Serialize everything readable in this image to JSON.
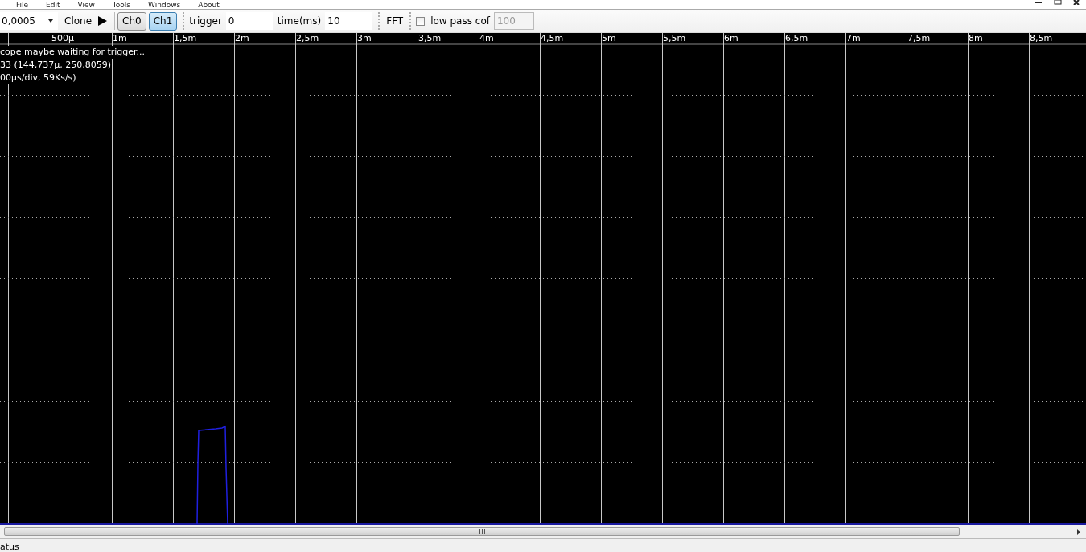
{
  "menu": [
    {
      "label": "File"
    },
    {
      "label": "Edit"
    },
    {
      "label": "View"
    },
    {
      "label": "Tools"
    },
    {
      "label": "Windows"
    },
    {
      "label": "About"
    }
  ],
  "toolbar": {
    "sample_combo": {
      "value": "0,0005"
    },
    "clone_button": "Clone",
    "channels": [
      {
        "label": "Ch0",
        "selected": false
      },
      {
        "label": "Ch1",
        "selected": true
      }
    ],
    "trigger": {
      "label": "trigger",
      "value": "0"
    },
    "time": {
      "label": "time(ms)",
      "value": "10"
    },
    "fft_button": "FFT",
    "low_pass": {
      "label": "low pass cof",
      "checked": false,
      "value": "100",
      "disabled": true
    }
  },
  "scope": {
    "ruler_labels": [
      "500µ",
      "1m",
      "1,5m",
      "2m",
      "2,5m",
      "3m",
      "3,5m",
      "4m",
      "4,5m",
      "5m",
      "5,5m",
      "6m",
      "6,5m",
      "7m",
      "7,5m",
      "8m",
      "8,5m"
    ],
    "overlay_lines": [
      "cope maybe waiting for trigger...",
      "33 (144,737µ, 250,8059)",
      "00µs/div, 59Ks/s)"
    ]
  },
  "status_bar": "atus"
}
